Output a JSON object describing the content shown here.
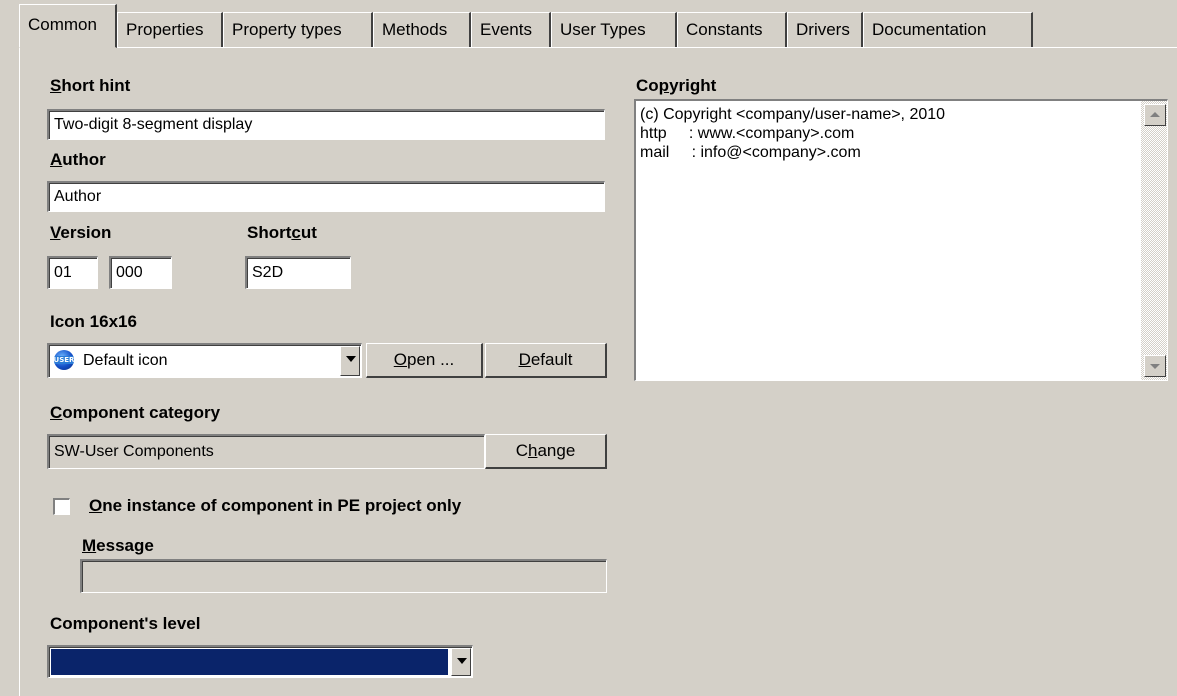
{
  "tabs": [
    {
      "label": "Common",
      "active": true
    },
    {
      "label": "Properties",
      "active": false
    },
    {
      "label": "Property types",
      "active": false
    },
    {
      "label": "Methods",
      "active": false
    },
    {
      "label": "Events",
      "active": false
    },
    {
      "label": "User Types",
      "active": false
    },
    {
      "label": "Constants",
      "active": false
    },
    {
      "label": "Drivers",
      "active": false
    },
    {
      "label": "Documentation",
      "active": false
    }
  ],
  "short_hint": {
    "label_first": "S",
    "label_rest": "hort hint",
    "value": "Two-digit 8-segment display"
  },
  "author": {
    "label_first": "A",
    "label_rest": "uthor",
    "value": "Author"
  },
  "version": {
    "label_first": "V",
    "label_rest": "ersion",
    "major": "01",
    "minor": "000"
  },
  "shortcut": {
    "label_pre": "Short",
    "label_key": "c",
    "label_post": "ut",
    "value": "S2D"
  },
  "icon": {
    "label": "Icon 16x16",
    "selected": "Default icon",
    "icon_name": "user-component-globe-icon",
    "open_key": "O",
    "open_rest": "pen ...",
    "default_key": "D",
    "default_rest": "efault"
  },
  "category": {
    "label_first": "C",
    "label_rest": "omponent category",
    "value": "SW-User Components",
    "change_pre": "C",
    "change_key": "h",
    "change_post": "ange"
  },
  "single_instance": {
    "checked": false,
    "label_key": "O",
    "label_rest": "ne instance of component in PE project only"
  },
  "message": {
    "label_key": "M",
    "label_rest": "essage",
    "value": ""
  },
  "level": {
    "label": "Component's level",
    "value": "",
    "fill_color": "#0a246a"
  },
  "copyright": {
    "label_pre": "Co",
    "label_key": "p",
    "label_post": "yright",
    "lines": [
      "(c) Copyright <company/user-name>, 2010",
      "http     : www.<company>.com",
      "mail     : info@<company>.com"
    ]
  },
  "colors": {
    "face": "#d4d0c8",
    "shadow": "#808080",
    "dark": "#404040",
    "highlight": "#ffffff"
  }
}
